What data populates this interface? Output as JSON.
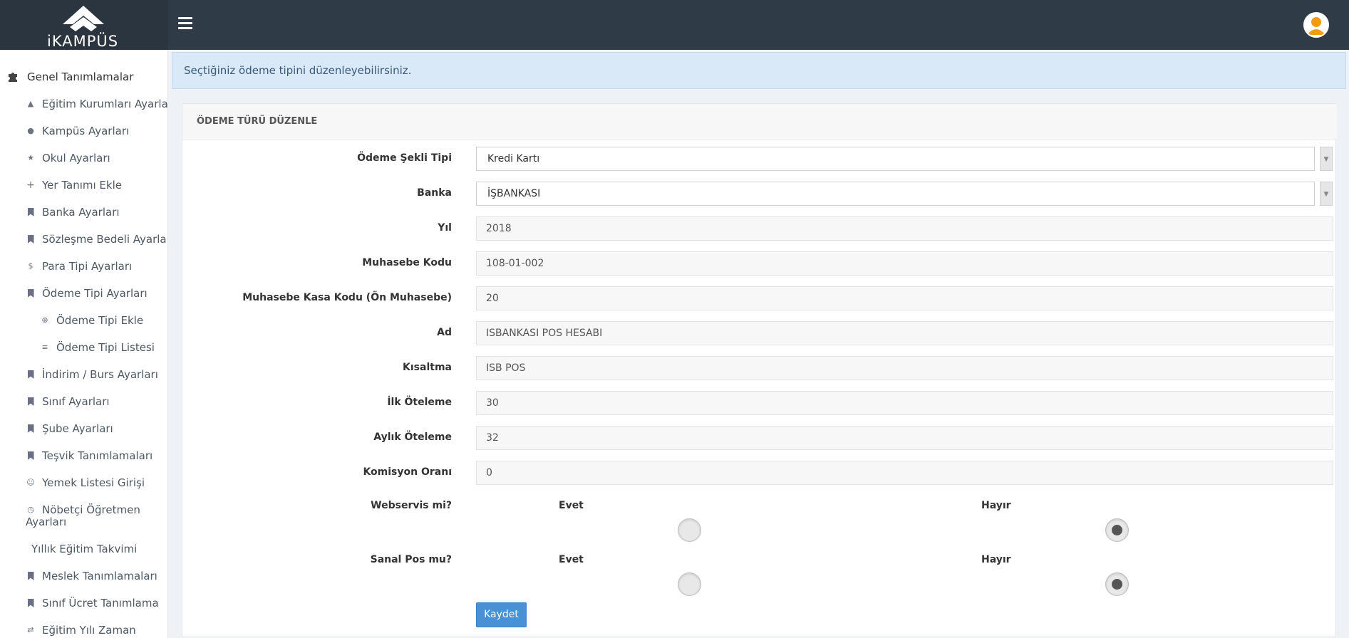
{
  "brand": {
    "logo_text": "iKAMPÜS"
  },
  "sidebar": {
    "items": [
      {
        "label": "Genel Tanımlamalar",
        "icon": "puzzle-icon"
      },
      {
        "label": "Eğitim Kurumları Ayarları",
        "icon": "graduation-cap-icon"
      },
      {
        "label": "Kampüs Ayarları",
        "icon": "map-pin-icon"
      },
      {
        "label": "Okul Ayarları",
        "icon": "star-icon"
      },
      {
        "label": "Yer Tanımı Ekle",
        "icon": "plus-icon"
      },
      {
        "label": "Banka Ayarları",
        "icon": "bookmark-icon"
      },
      {
        "label": "Sözleşme Bedeli Ayarları",
        "icon": "bookmark-icon"
      },
      {
        "label": "Para Tipi Ayarları",
        "icon": "dollar-icon"
      },
      {
        "label": "Ödeme Tipi Ayarları",
        "icon": "bookmark-icon"
      },
      {
        "label": "Ödeme Tipi Ekle",
        "icon": "plus-circle-icon"
      },
      {
        "label": "Ödeme Tipi Listesi",
        "icon": "list-icon"
      },
      {
        "label": "İndirim / Burs Ayarları",
        "icon": "bookmark-icon"
      },
      {
        "label": "Sınıf Ayarları",
        "icon": "bookmark-icon"
      },
      {
        "label": "Şube Ayarları",
        "icon": "bookmark-icon"
      },
      {
        "label": "Teşvik Tanımlamaları",
        "icon": "bookmark-icon"
      },
      {
        "label": "Yemek Listesi Girişi",
        "icon": "smile-icon"
      },
      {
        "label": "Nöbetçi Öğretmen",
        "label2": "Ayarları",
        "icon": "clock-icon"
      },
      {
        "label": "Yıllık Eğitim Takvimi",
        "icon": ""
      },
      {
        "label": "Meslek Tanımlamaları",
        "icon": "bookmark-icon"
      },
      {
        "label": "Sınıf Ücret Tanımlama",
        "icon": "bookmark-icon"
      },
      {
        "label": "Eğitim Yılı Zaman",
        "icon": "exchange-icon"
      }
    ]
  },
  "alert": {
    "text": "Seçtiğiniz ödeme tipini düzenleyebilirsiniz."
  },
  "panel": {
    "title": "ÖDEME TÜRÜ DÜZENLE",
    "fields": {
      "odeme_sekli_tipi": {
        "label": "Ödeme Şekli Tipi",
        "value": "Kredi Kartı"
      },
      "banka": {
        "label": "Banka",
        "value": "İŞBANKASI"
      },
      "yil": {
        "label": "Yıl",
        "value": "2018"
      },
      "muhasebe_kodu": {
        "label": "Muhasebe Kodu",
        "value": "108-01-002"
      },
      "kasa_kodu": {
        "label": "Muhasebe Kasa Kodu (Ön Muhasebe)",
        "value": "20"
      },
      "ad": {
        "label": "Ad",
        "value": "ISBANKASI POS HESABI"
      },
      "kisaltma": {
        "label": "Kısaltma",
        "value": "ISB POS"
      },
      "ilk_oteleme": {
        "label": "İlk Öteleme",
        "value": "30"
      },
      "aylik_oteleme": {
        "label": "Aylık Öteleme",
        "value": "32"
      },
      "komisyon_orani": {
        "label": "Komisyon Oranı",
        "value": "0"
      }
    },
    "webservis": {
      "label": "Webservis mi?",
      "yes": "Evet",
      "no": "Hayır",
      "selected": "Hayır"
    },
    "sanal_pos": {
      "label": "Sanal Pos mu?",
      "yes": "Evet",
      "no": "Hayır",
      "selected": "Hayır"
    },
    "save_label": "Kaydet"
  },
  "colors": {
    "topbar": "#2f3b46",
    "accent": "#4a90d4",
    "alert_bg": "#d9e9f7"
  }
}
